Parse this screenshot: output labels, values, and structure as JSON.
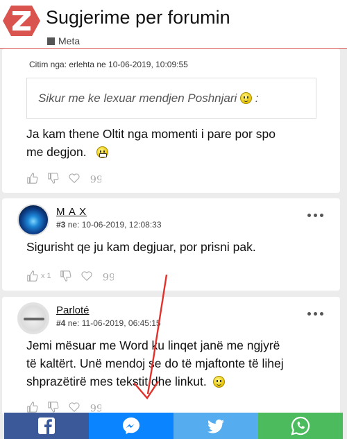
{
  "header": {
    "title": "Sugjerime per forumin",
    "category": "Meta",
    "brand_color": "#d9534f"
  },
  "post1": {
    "cite_header": "Citim nga: erlehta ne 10-06-2019, 10:09:55",
    "quote_text": "Sikur me ke lexuar mendjen Poshnjari",
    "quote_suffix": ":",
    "body_line1": "Ja kam thene Oltit nga momenti i pare por spo",
    "body_line2": "me degjon."
  },
  "post2": {
    "author": "M A X",
    "post_number": "#3",
    "date_prefix": "ne:",
    "date": "10-06-2019, 12:08:33",
    "body": "Sigurisht qe ju kam degjuar, por prisni pak.",
    "like_count": "x 1"
  },
  "post3": {
    "author": "Parloté",
    "post_number": "#4",
    "date_prefix": "ne:",
    "date": "11-06-2019, 06:45:15",
    "body_line1": "Jemi mësuar me Word ku linqet janë me ngjyrë",
    "body_line2": "të kaltërt. Unë mendoj se do të mjaftonte të lihej",
    "body_line3": "shprazëtirë mes tekstit dhe linkut."
  },
  "share": {
    "facebook_color": "#3b5998",
    "messenger_color": "#0a84ff",
    "twitter_color": "#55acee",
    "whatsapp_color": "#4cbb5e"
  },
  "icons": [
    "forum-logo-icon",
    "like-icon",
    "dislike-icon",
    "heart-icon",
    "quote-icon",
    "more-icon",
    "facebook-icon",
    "messenger-icon",
    "twitter-icon",
    "whatsapp-icon"
  ]
}
